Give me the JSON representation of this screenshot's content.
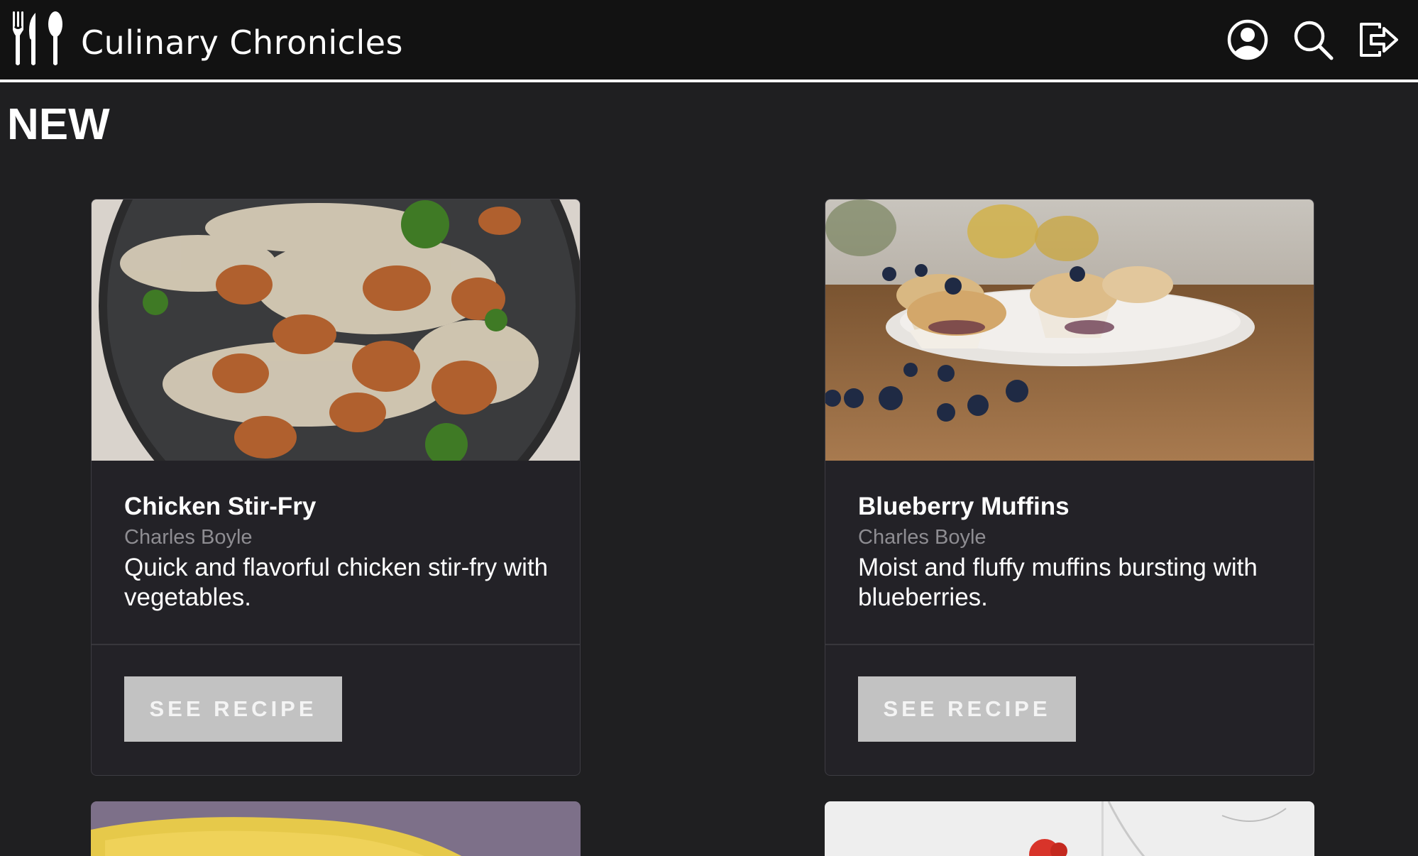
{
  "header": {
    "app_title": "Culinary Chronicles",
    "logo_icon": "utensils-icon",
    "icons": [
      "user-circle-icon",
      "search-icon",
      "logout-icon"
    ]
  },
  "section": {
    "title": "NEW"
  },
  "recipes": [
    {
      "title": "Chicken Stir-Fry",
      "author": "Charles Boyle",
      "description": "Quick and flavorful chicken stir-fry with vegetables.",
      "button_label": "SEE RECIPE",
      "image": "chicken-stir-fry-photo"
    },
    {
      "title": "Blueberry Muffins",
      "author": "Charles Boyle",
      "description": "Moist and fluffy muffins bursting with blueberries.",
      "button_label": "SEE RECIPE",
      "image": "blueberry-muffins-photo"
    }
  ],
  "colors": {
    "background": "#1f1f21",
    "header": "#121212",
    "card": "#232227",
    "button": "#c2c2c2",
    "author_text": "#8e8d92"
  }
}
